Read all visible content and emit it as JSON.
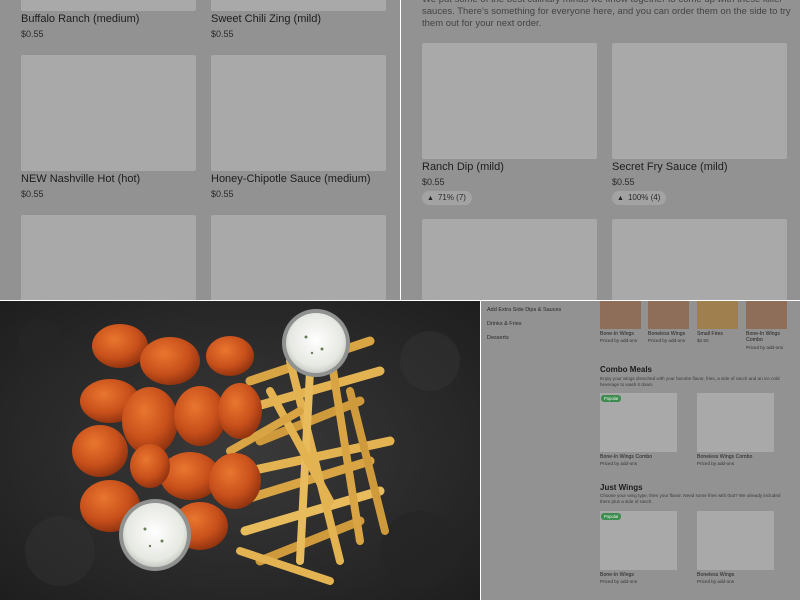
{
  "q1": {
    "items": [
      {
        "title": "Buffalo Ranch (medium)",
        "price": "$0.55"
      },
      {
        "title": "Sweet Chili Zing (mild)",
        "price": "$0.55"
      },
      {
        "title": "NEW Nashville Hot (hot)",
        "price": "$0.55"
      },
      {
        "title": "Honey-Chipotle Sauce (medium)",
        "price": "$0.55"
      }
    ]
  },
  "q2": {
    "intro": "We put some of the best culinary minds we know together to come up with these killer sauces. There's something for everyone here, and you can order them on the side to try them out for your next order.",
    "items": [
      {
        "title": "Ranch Dip (mild)",
        "price": "$0.55",
        "rating": "71% (7)"
      },
      {
        "title": "Secret Fry Sauce (mild)",
        "price": "$0.55",
        "rating": "100% (4)"
      }
    ],
    "thumb_icon": "thumbs-up-icon"
  },
  "q4": {
    "sidebar": [
      {
        "label": "Add Extra Side Dips & Sauces"
      },
      {
        "label": "Drinks & Fries"
      },
      {
        "label": "Desserts"
      }
    ],
    "top_items": [
      {
        "title": "Bone-In Wings",
        "sub": "Priced by add-ons"
      },
      {
        "title": "Boneless Wings",
        "sub": "Priced by add-ons"
      },
      {
        "title": "Small Fries",
        "sub": "$2.50"
      },
      {
        "title": "Bone-In Wings Combo",
        "sub": "Priced by add-ons"
      }
    ],
    "combo": {
      "title": "Combo Meals",
      "desc": "Enjoy your wings drenched with your favorite flavor, fries, a side of ranch and an ice cold beverage to wash it down.",
      "badge": "Popular",
      "items": [
        {
          "title": "Bone-In Wings Combo",
          "sub": "Priced by add-ons"
        },
        {
          "title": "Boneless Wings Combo",
          "sub": "Priced by add-ons"
        }
      ]
    },
    "just_wings": {
      "title": "Just Wings",
      "desc": "Choose your wing type, then your flavor. Need some fries with that? We already included them plus a side of ranch.",
      "badge": "Popular",
      "items": [
        {
          "title": "Bone-In Wings",
          "sub": "Priced by add-ons"
        },
        {
          "title": "Boneless Wings",
          "sub": "Priced by add-ons"
        }
      ]
    }
  },
  "colors": {
    "overlay_gray": "#929292",
    "placeholder": "#a9a9a9",
    "popular_badge": "#3f8c50",
    "photo_background": "#2b2b2b",
    "wing_orange": "#c8501b",
    "fries_yellow": "#e3b352",
    "ranch_white": "#f1f2ee"
  }
}
